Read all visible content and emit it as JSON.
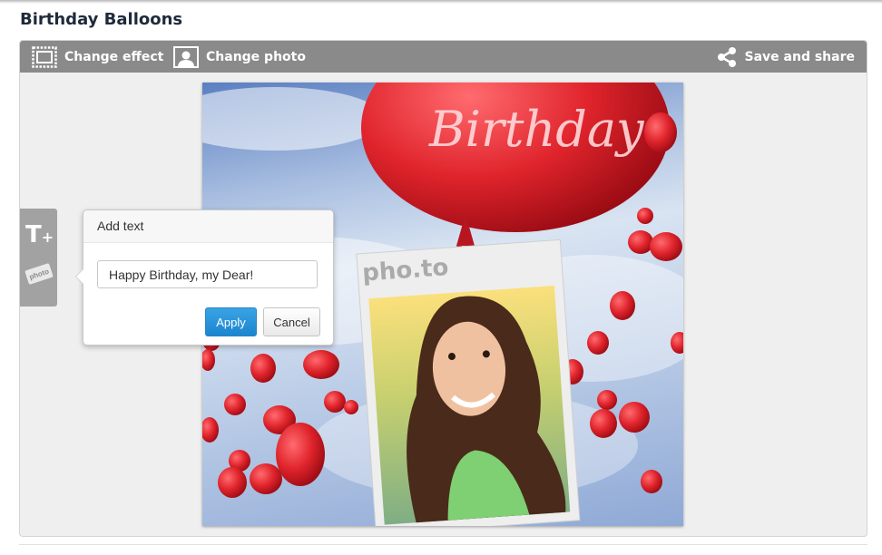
{
  "page": {
    "title": "Birthday Balloons"
  },
  "toolbar": {
    "change_effect": {
      "label": "Change effect",
      "icon": "frame-icon"
    },
    "change_photo": {
      "label": "Change photo",
      "icon": "portrait-icon"
    },
    "save_share": {
      "label": "Save and share",
      "icon": "share-icon"
    }
  },
  "side_tools": {
    "add_text": {
      "label": "T+",
      "icon": "add-text-icon"
    },
    "stamp": {
      "label": "photo",
      "icon": "stamp-icon"
    }
  },
  "add_text_popover": {
    "title": "Add text",
    "input_value": "Happy Birthday, my Dear!",
    "apply_label": "Apply",
    "cancel_label": "Cancel"
  },
  "canvas": {
    "balloon_text": "Birthday",
    "watermark": "pho.to"
  },
  "colors": {
    "toolbar": "#8a8a8a",
    "apply": "#1a86cf",
    "balloon": "#e0242c"
  }
}
